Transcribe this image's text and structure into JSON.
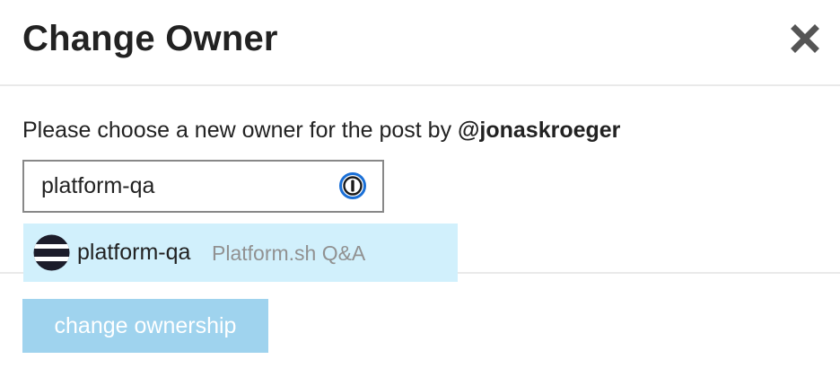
{
  "modal": {
    "title": "Change Owner",
    "close_icon": "close-icon"
  },
  "body": {
    "instructions_prefix": "Please choose a new owner for the post by ",
    "post_author": "@jonaskroeger",
    "search": {
      "value": "platform-qa",
      "placeholder": "",
      "password_manager_icon": "password-manager-icon"
    },
    "autocomplete": {
      "items": [
        {
          "username": "platform-qa",
          "full_name": "Platform.sh Q&A",
          "avatar_icon": "user-avatar"
        }
      ],
      "highlight_color": "#d1f0fc"
    }
  },
  "footer": {
    "submit_label": "change ownership",
    "submit_disabled": true,
    "submit_color": "#9fd3ee"
  }
}
